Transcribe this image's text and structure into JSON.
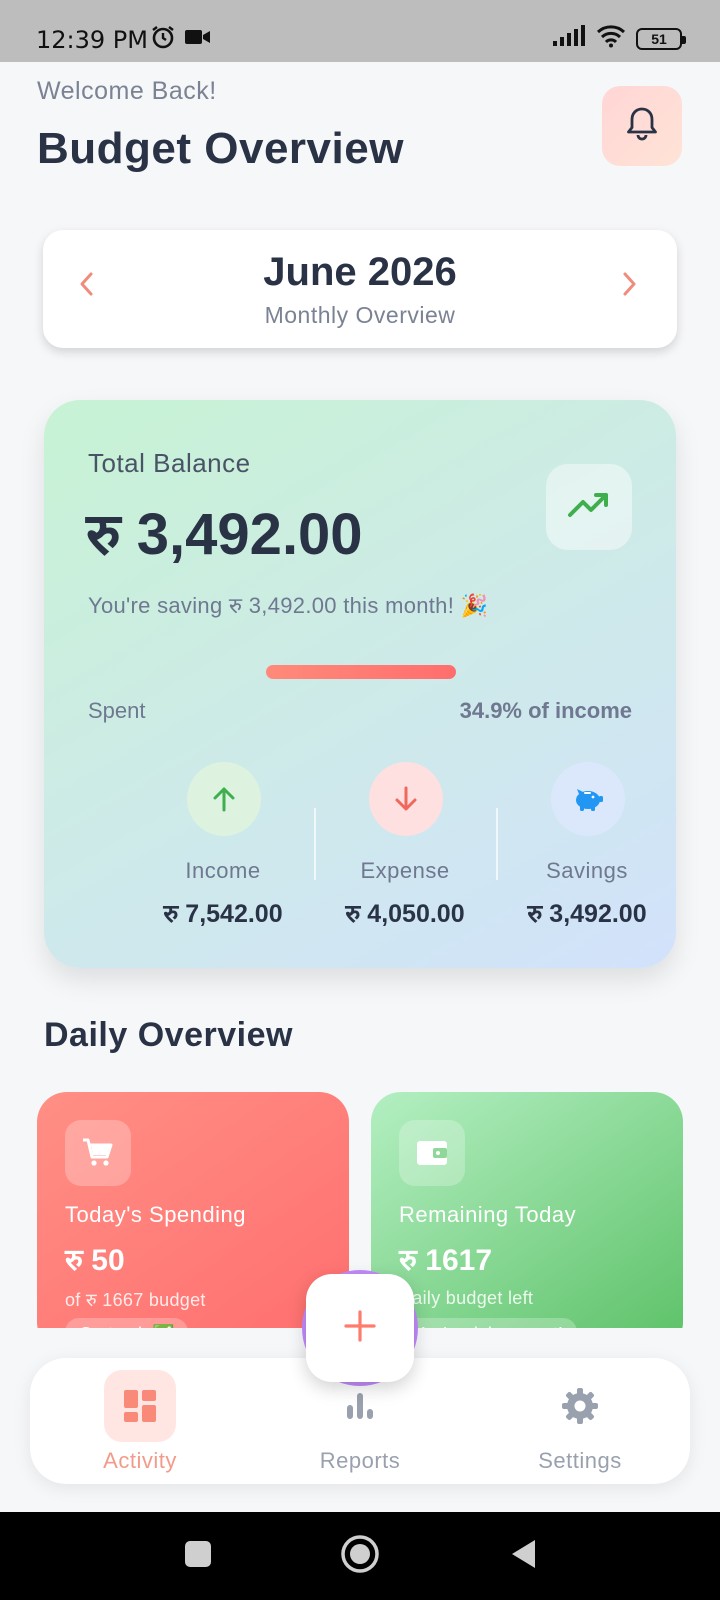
{
  "status_bar": {
    "time": "12:39 PM",
    "battery": "51",
    "icons": [
      "alarm-icon",
      "video-icon",
      "signal-icon",
      "wifi-icon",
      "battery-icon"
    ]
  },
  "header": {
    "welcome": "Welcome Back!",
    "title": "Budget Overview"
  },
  "month_selector": {
    "month": "June 2026",
    "subtitle": "Monthly Overview"
  },
  "balance": {
    "label": "Total Balance",
    "amount": "रु 3,492.00",
    "saving_message": "You're saving रु 3,492.00 this month! 🎉",
    "spent_label": "Spent",
    "spent_percent_text": "34.9% of income",
    "spent_fraction": 0.349,
    "stats": [
      {
        "label": "Income",
        "value": "रु 7,542.00",
        "icon": "arrow-up-icon"
      },
      {
        "label": "Expense",
        "value": "रु 4,050.00",
        "icon": "arrow-down-icon"
      },
      {
        "label": "Savings",
        "value": "रु 3,492.00",
        "icon": "piggy-bank-icon"
      }
    ]
  },
  "daily": {
    "title": "Daily Overview",
    "cards": [
      {
        "title": "Today's Spending",
        "value": "रु 50",
        "sub": "of रु 1667 budget",
        "pill": "On track ✅",
        "icon": "cart-icon"
      },
      {
        "title": "Remaining Today",
        "value": "रु 1617",
        "sub": "Daily budget left",
        "pill": "You're doing great!",
        "icon": "wallet-icon"
      }
    ]
  },
  "nav": {
    "items": [
      {
        "label": "Activity",
        "icon": "dashboard-icon",
        "active": true
      },
      {
        "label": "Reports",
        "icon": "bar-chart-icon",
        "active": false
      },
      {
        "label": "Settings",
        "icon": "gear-icon",
        "active": false
      }
    ]
  },
  "colors": {
    "accent": "#ff7b72",
    "text_dark": "#2a3345",
    "green": "#4caf50"
  }
}
